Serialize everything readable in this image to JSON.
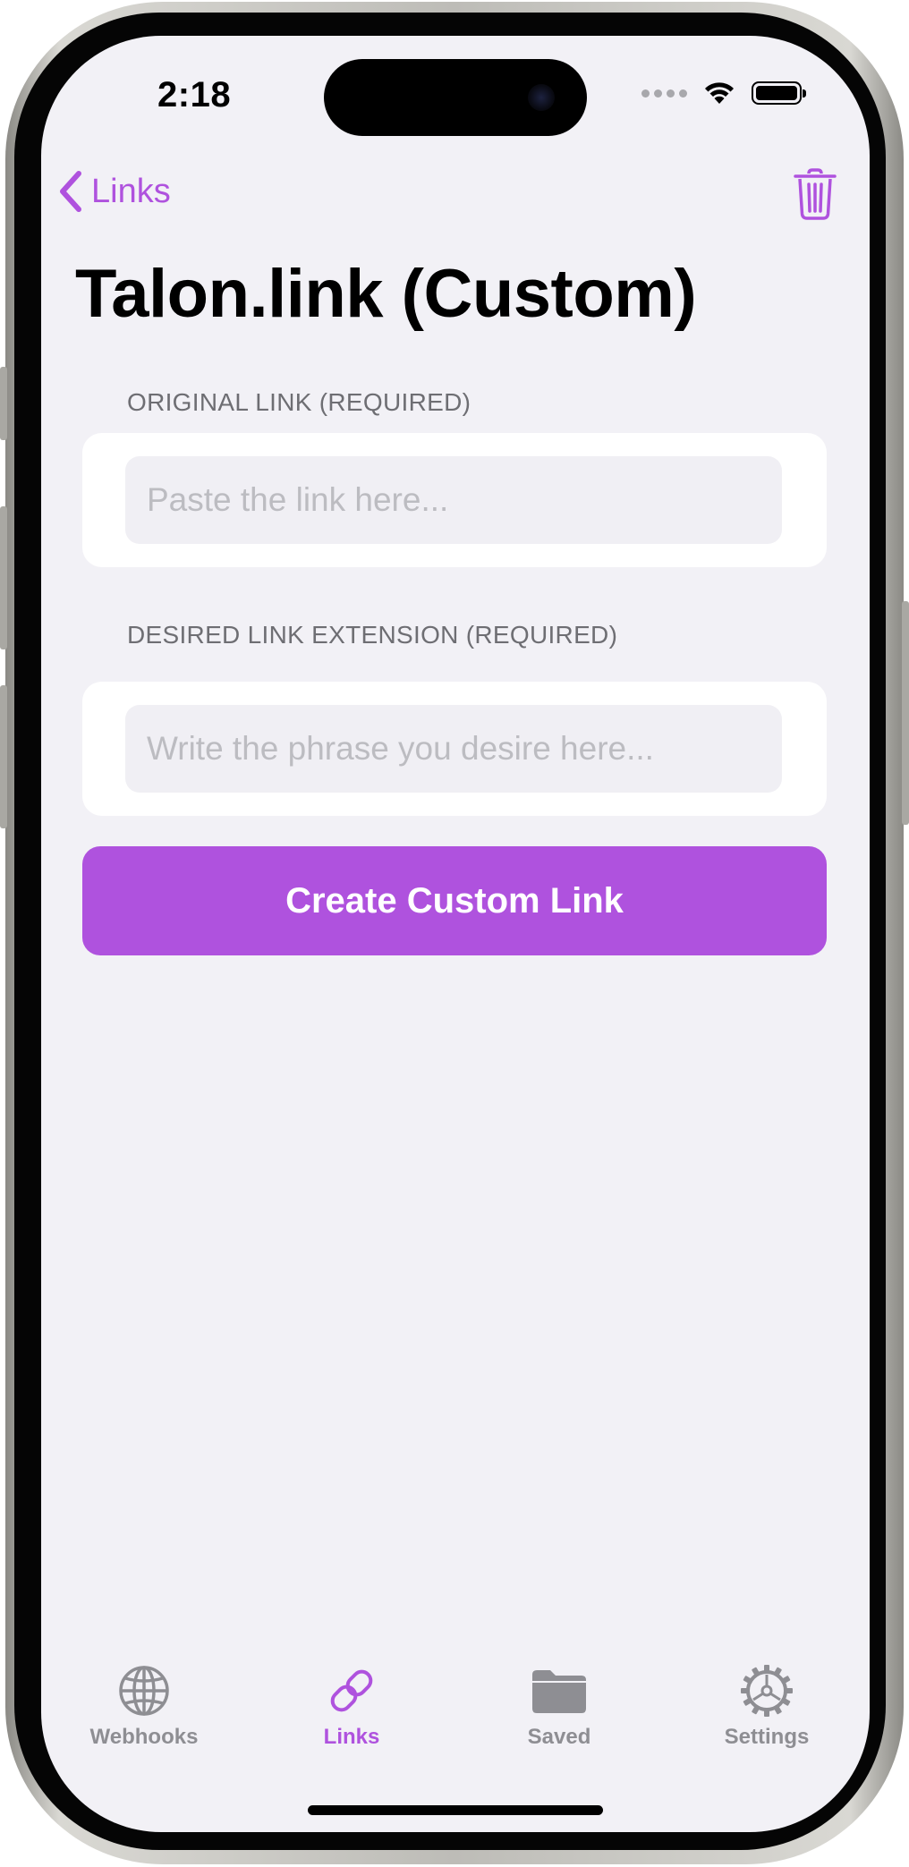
{
  "status_bar": {
    "time": "2:18"
  },
  "nav": {
    "back_label": "Links",
    "back_icon": "chevron-left-icon",
    "trash_icon": "trash-icon"
  },
  "page": {
    "title": "Talon.link (Custom)"
  },
  "form": {
    "original_link": {
      "label": "ORIGINAL LINK (REQUIRED)",
      "placeholder": "Paste the link here...",
      "value": ""
    },
    "extension": {
      "label": "DESIRED LINK EXTENSION (REQUIRED)",
      "placeholder": "Write the phrase you desire here...",
      "value": ""
    },
    "submit_label": "Create Custom Link"
  },
  "tabs": [
    {
      "label": "Webhooks",
      "icon": "globe-icon",
      "active": false
    },
    {
      "label": "Links",
      "icon": "link-icon",
      "active": true
    },
    {
      "label": "Saved",
      "icon": "folder-icon",
      "active": false
    },
    {
      "label": "Settings",
      "icon": "gear-icon",
      "active": false
    }
  ],
  "colors": {
    "accent": "#af52de",
    "background": "#f2f1f6",
    "inactive_tab": "#8e8e93"
  }
}
